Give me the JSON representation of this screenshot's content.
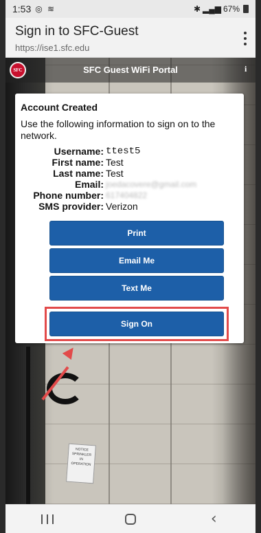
{
  "status_bar": {
    "time": "1:53",
    "left_icons": [
      "whatsapp-icon",
      "wifi-icon"
    ],
    "right_icons": [
      "nfc-icon",
      "mute-icon",
      "wifi-icon",
      "signal-icon"
    ],
    "battery": "67%"
  },
  "browser": {
    "title": "Sign in to SFC-Guest",
    "url": "https://ise1.sfc.edu"
  },
  "portal": {
    "logo_text": "SFC",
    "title": "SFC Guest WiFi Portal",
    "info_icon": "i"
  },
  "card": {
    "title": "Account Created",
    "description": "Use the following information to sign on to the network.",
    "fields": [
      {
        "label": "Username:",
        "value": "ttest5"
      },
      {
        "label": "First name:",
        "value": "Test"
      },
      {
        "label": "Last name:",
        "value": "Test"
      },
      {
        "label": "Email:",
        "value": "joedacovere@gmail.com"
      },
      {
        "label": "Phone number:",
        "value": "617404822"
      },
      {
        "label": "SMS provider:",
        "value": "Verizon"
      }
    ],
    "buttons": {
      "print": "Print",
      "email_me": "Email Me",
      "text_me": "Text Me",
      "sign_on": "Sign On"
    }
  },
  "sign_text": "NOTICE SPRINKLER IN OPERATION",
  "colors": {
    "button_blue": "#1d5fa8",
    "highlight_red": "#e24a4a",
    "logo_red": "#c8102e"
  }
}
